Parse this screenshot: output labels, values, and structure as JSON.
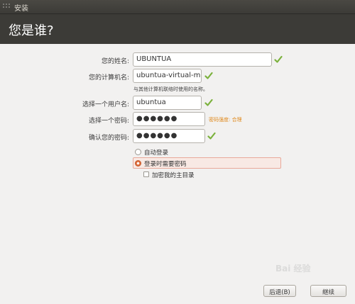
{
  "window": {
    "title": "安装"
  },
  "header": {
    "title": "您是谁?"
  },
  "form": {
    "name": {
      "label": "您的姓名:",
      "value": "UBUNTUA"
    },
    "computer": {
      "label": "您的计算机名:",
      "value": "ubuntua-virtual-mach",
      "hint": "与其他计算机联络时使用的名称。"
    },
    "username": {
      "label": "选择一个用户名:",
      "value": "ubuntua"
    },
    "password": {
      "label": "选择一个密码:",
      "value": "●●●●●●",
      "strength": "密码强度: 合理"
    },
    "confirm": {
      "label": "确认您的密码:",
      "value": "●●●●●●"
    }
  },
  "options": {
    "auto_login": "自动登录",
    "require_password": "登录时需要密码",
    "encrypt_home": "加密我的主目录"
  },
  "buttons": {
    "back": "后退(B)",
    "continue": "继续"
  },
  "watermark": "Bai 经验",
  "colors": {
    "check": "#7bb13c",
    "accent": "#df6c3a",
    "header": "#3c3b37"
  }
}
